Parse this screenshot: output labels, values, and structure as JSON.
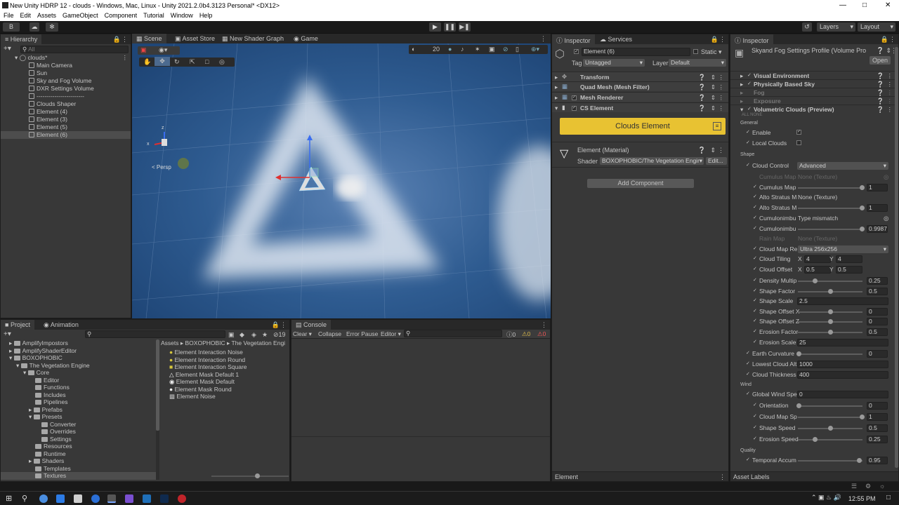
{
  "window": {
    "title": "New Unity HDRP 12 - clouds - Windows, Mac, Linux - Unity 2021.2.0b4.3123 Personal* <DX12>"
  },
  "menu": [
    "File",
    "Edit",
    "Assets",
    "GameObject",
    "Component",
    "Tutorial",
    "Window",
    "Help"
  ],
  "toolbar": {
    "account": "B",
    "layers": "Layers",
    "layout": "Layout"
  },
  "hierarchy": {
    "tab": "Hierarchy",
    "search_placeholder": "All",
    "scene": "clouds*",
    "items": [
      "Main Camera",
      "Sun",
      "Sky and Fog Volume",
      "DXR Settings Volume",
      "------------------------",
      "Clouds Shaper",
      "Element (4)",
      "Element (3)",
      "Element (5)",
      "Element (6)"
    ]
  },
  "scene_tabs": [
    "Scene",
    "Asset Store",
    "New Shader Graph",
    "Game"
  ],
  "scene": {
    "gizmo_label": "< Persp",
    "gizmo_x": "x",
    "gizmo_z": "z",
    "camera_speed": "20"
  },
  "project": {
    "tabs": [
      "Project",
      "Animation"
    ],
    "tree": [
      "AmplifyImpostors",
      "AmplifyShaderEditor",
      "BOXOPHOBIC",
      "The Vegetation Engine",
      "Core",
      "Editor",
      "Functions",
      "Includes",
      "Pipelines",
      "Prefabs",
      "Presets",
      "Converter",
      "Overrides",
      "Settings",
      "Resources",
      "Runtime",
      "Shaders",
      "Templates",
      "Textures"
    ],
    "hidden_count": "19",
    "breadcrumb": [
      "Assets",
      "BOXOPHOBIC",
      "The Vegetation Engi"
    ],
    "files": [
      "Element Interaction Noise",
      "Element Interaction Round",
      "Element Interaction Square",
      "Element Mask Default 1",
      "Element Mask Default",
      "Element Mask Round",
      "Element Noise"
    ]
  },
  "console": {
    "tab": "Console",
    "clear": "Clear",
    "collapse": "Collapse",
    "error_pause": "Error Pause",
    "editor": "Editor",
    "count_info": "0",
    "count_warn": "0",
    "count_err": "0"
  },
  "inspector": {
    "tabs": [
      "Inspector",
      "Services"
    ],
    "object_name": "Element (6)",
    "static_label": "Static",
    "tag_label": "Tag",
    "tag_value": "Untagged",
    "layer_label": "Layer",
    "layer_value": "Default",
    "components": [
      "Transform",
      "Quad Mesh (Mesh Filter)",
      "Mesh Renderer",
      "CS Element"
    ],
    "cs_button": "Clouds Element",
    "material_name": "Element (Material)",
    "shader_label": "Shader",
    "shader_value": "BOXOPHOBIC/The Vegetation Engin",
    "edit_label": "Edit...",
    "add_component": "Add Component",
    "status": "Element"
  },
  "inspector2": {
    "tab": "Inspector",
    "title": "Skyand Fog Settings Profile (Volume Pro",
    "open": "Open",
    "overrides": [
      "Visual Environment",
      "Physically Based Sky",
      "Fog",
      "Exposure",
      "Volumetric Clouds (Preview)"
    ],
    "all_none": "ALL  NONE",
    "sections": {
      "general": "General",
      "shape": "Shape",
      "wind": "Wind",
      "quality": "Quality"
    },
    "enable": "Enable",
    "local_clouds": "Local Clouds",
    "cloud_control": "Cloud Control",
    "cloud_control_value": "Advanced",
    "props": [
      {
        "label": "Cumulus Map",
        "value": "None (Texture)"
      },
      {
        "label": "Cumulus Map",
        "value": "1"
      },
      {
        "label": "Alto Stratus M",
        "value": "None (Texture)"
      },
      {
        "label": "Alto Stratus M",
        "value": "1"
      },
      {
        "label": "Cumulonimbu",
        "value": "Type mismatch"
      },
      {
        "label": "Cumulonimbu",
        "value": "0.99876"
      },
      {
        "label": "Rain Map",
        "value": "None (Texture)"
      },
      {
        "label": "Cloud Map Re",
        "value": "Ultra 256x256"
      }
    ],
    "cloud_tiling": {
      "label": "Cloud Tiling",
      "x": "4",
      "y": "4"
    },
    "cloud_offset": {
      "label": "Cloud Offset",
      "x": "0.5",
      "y": "0.5"
    },
    "shape_props": [
      {
        "label": "Density Multip",
        "value": "0.25",
        "level": 0.25
      },
      {
        "label": "Shape Factor",
        "value": "0.5",
        "level": 0.5
      },
      {
        "label": "Shape Scale",
        "value": "2.5"
      },
      {
        "label": "Shape Offset X",
        "value": "0",
        "level": 0.5
      },
      {
        "label": "Shape Offset Z",
        "value": "0",
        "level": 0.5
      },
      {
        "label": "Erosion Factor",
        "value": "0.5",
        "level": 0.5
      },
      {
        "label": "Erosion Scale",
        "value": "25"
      }
    ],
    "earth_curvature": {
      "label": "Earth Curvature",
      "value": "0",
      "level": 0
    },
    "lowest_cloud": {
      "label": "Lowest Cloud Alt",
      "value": "1000"
    },
    "cloud_thickness": {
      "label": "Cloud Thickness",
      "value": "400"
    },
    "wind_speed": {
      "label": "Global Wind Spe",
      "value": "0"
    },
    "wind_props": [
      {
        "label": "Orientation",
        "value": "0",
        "level": 0
      },
      {
        "label": "Cloud Map Sp",
        "value": "1",
        "level": 1
      },
      {
        "label": "Shape Speed",
        "value": "0.5",
        "level": 0.5
      },
      {
        "label": "Erosion Speed",
        "value": "0.25",
        "level": 0.25
      }
    ],
    "temporal": {
      "label": "Temporal Accum",
      "value": "0.95",
      "level": 0.95
    },
    "status": "Asset Labels"
  },
  "taskbar": {
    "time": "12:55 PM"
  },
  "colors": {
    "accent": "#2c5d87",
    "cs_button": "#e8c232",
    "sky": "#2d5a8e"
  }
}
